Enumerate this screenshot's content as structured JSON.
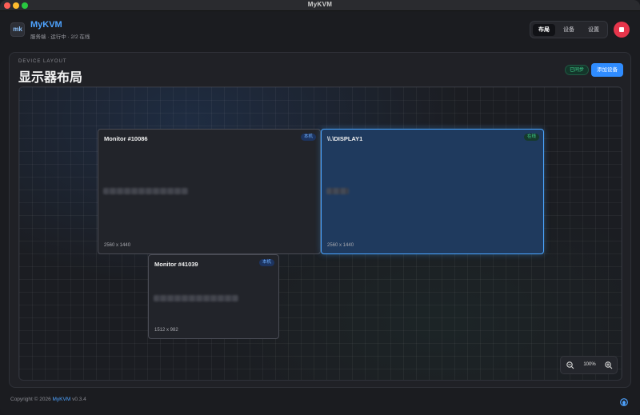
{
  "window": {
    "title": "MyKVM"
  },
  "header": {
    "logo_text": "mk",
    "app_name": "MyKVM",
    "status": "服务端 · 运行中 · 2/2 在线",
    "tabs": [
      {
        "label": "布局",
        "active": true
      },
      {
        "label": "设备",
        "active": false
      },
      {
        "label": "设置",
        "active": false
      }
    ]
  },
  "layout": {
    "eyebrow": "DEVICE LAYOUT",
    "title": "显示器布局",
    "sync_badge": "已同步",
    "add_button": "添加设备",
    "monitors": [
      {
        "name": "Monitor #10086",
        "badge": "本机",
        "resolution": "2560 x 1440",
        "selected": false
      },
      {
        "name": "\\\\.\\DISPLAY1",
        "badge": "在线",
        "resolution": "2560 x 1440",
        "selected": true
      },
      {
        "name": "Monitor #41039",
        "badge": "本机",
        "resolution": "1512 x 982",
        "selected": false
      }
    ],
    "zoom": "100%"
  },
  "footer": {
    "copyright": "Copyright © 2026",
    "brand": "MyKVM",
    "version": "v0.3.4"
  },
  "colors": {
    "accent": "#2f8cff",
    "stop": "#e6354b",
    "online": "#3fd28e"
  }
}
